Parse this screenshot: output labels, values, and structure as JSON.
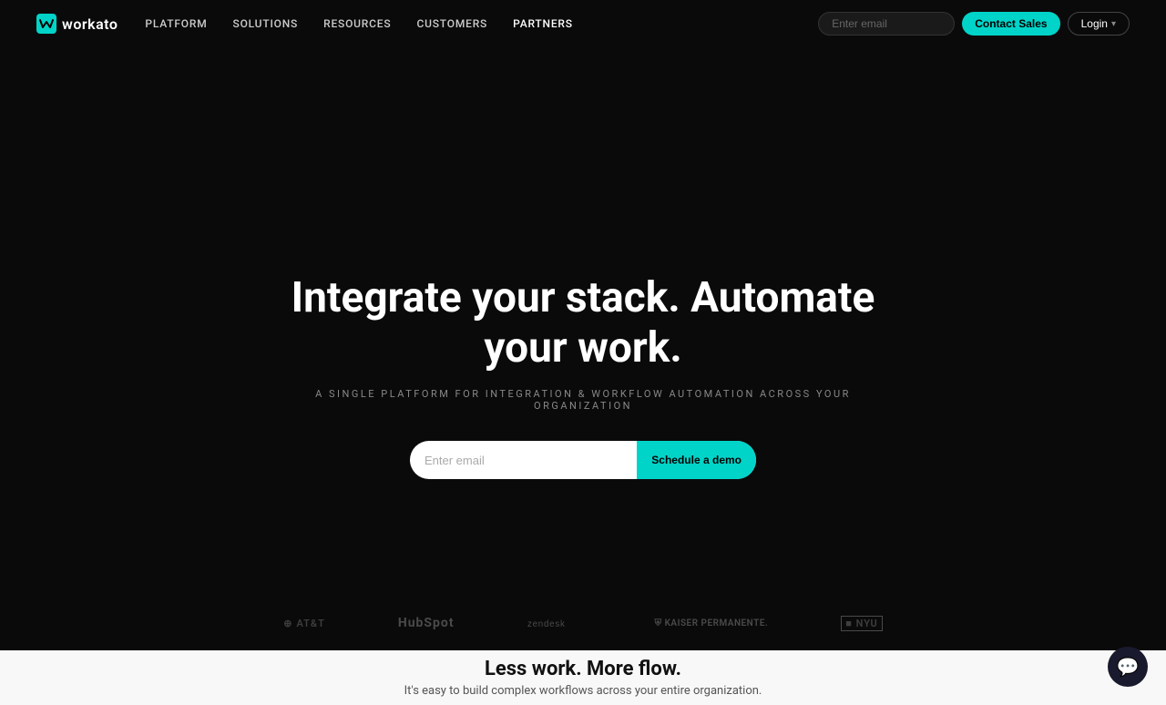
{
  "nav": {
    "logo_text": "workato",
    "links": [
      {
        "label": "PLATFORM",
        "id": "platform"
      },
      {
        "label": "SOLUTIONS",
        "id": "solutions"
      },
      {
        "label": "RESOURCES",
        "id": "resources"
      },
      {
        "label": "CUSTOMERS",
        "id": "customers"
      },
      {
        "label": "PARTNERS",
        "id": "partners"
      }
    ],
    "email_placeholder": "Enter email",
    "contact_sales_label": "Contact Sales",
    "login_label": "Login"
  },
  "hero": {
    "title": "Integrate your stack. Automate your work.",
    "subtitle": "A SINGLE PLATFORM FOR INTEGRATION & WORKFLOW AUTOMATION ACROSS YOUR ORGANIZATION",
    "email_placeholder": "Enter email",
    "cta_label": "Schedule a demo"
  },
  "logos": [
    {
      "id": "att",
      "text": "AT&T",
      "prefix": "⊕"
    },
    {
      "id": "hubspot",
      "text": "HubSpot"
    },
    {
      "id": "zendesk",
      "text": "zendesk"
    },
    {
      "id": "kaiser",
      "text": "KAISER PERMANENTE."
    },
    {
      "id": "nyu",
      "text": "NYU"
    }
  ],
  "bottom": {
    "title": "Less work. More flow.",
    "subtitle": "It's easy to build complex workflows across your entire organization."
  },
  "chat": {
    "label": "Chat"
  },
  "colors": {
    "accent": "#00d4c8",
    "background": "#0a0a0a",
    "white_section": "#f8f8f8"
  }
}
